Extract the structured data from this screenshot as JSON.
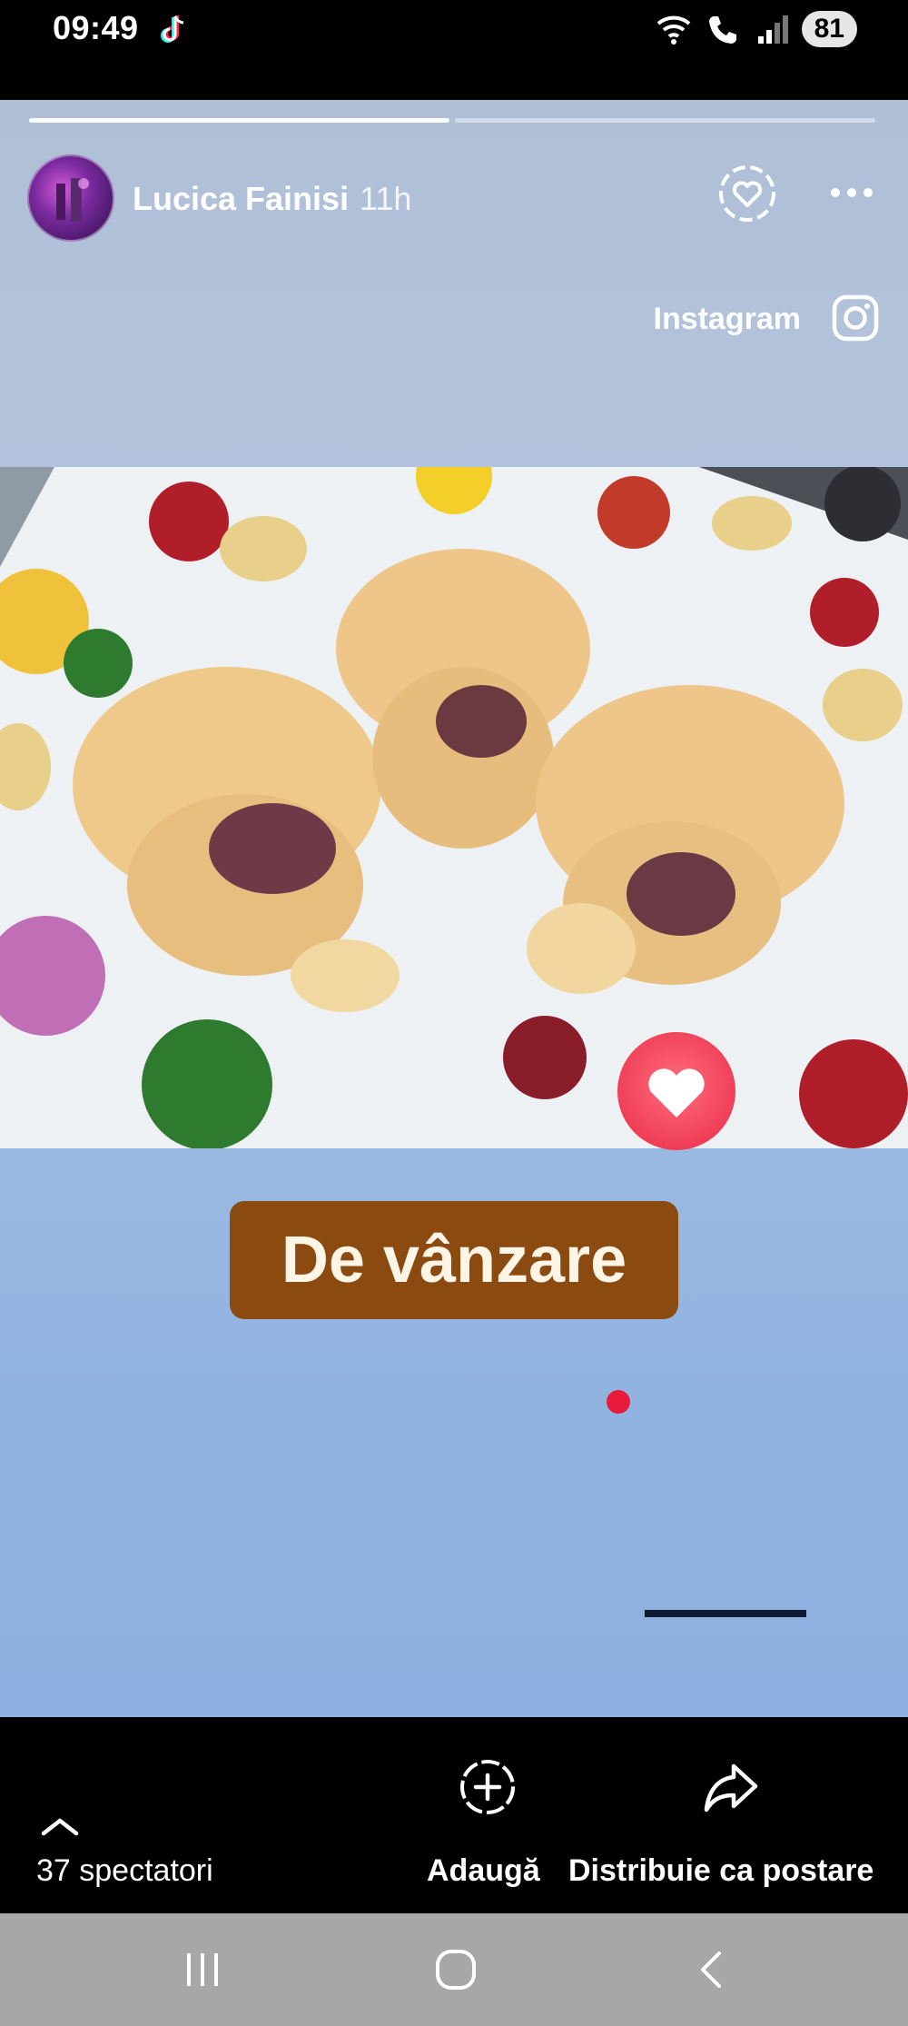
{
  "status_bar": {
    "time": "09:49",
    "battery": "81",
    "icons": [
      "tiktok-icon",
      "wifi-icon",
      "call-icon",
      "signal-icon"
    ]
  },
  "story": {
    "progress": [
      1,
      0
    ],
    "username": "Lucica Fainisi",
    "time_ago": "11h",
    "source_label": "Instagram",
    "sticker_text": "De vânzare",
    "accent_colors": {
      "sticker_bg": "#8b4a10",
      "heart": "#ef3f57",
      "dot": "#e8193a"
    }
  },
  "bottom_bar": {
    "viewers_label": "37 spectatori",
    "add_label": "Adaugă",
    "share_label": "Distribuie ca postare"
  },
  "nav_bar": {
    "icons": [
      "recent-apps-icon",
      "home-icon",
      "back-icon"
    ]
  }
}
